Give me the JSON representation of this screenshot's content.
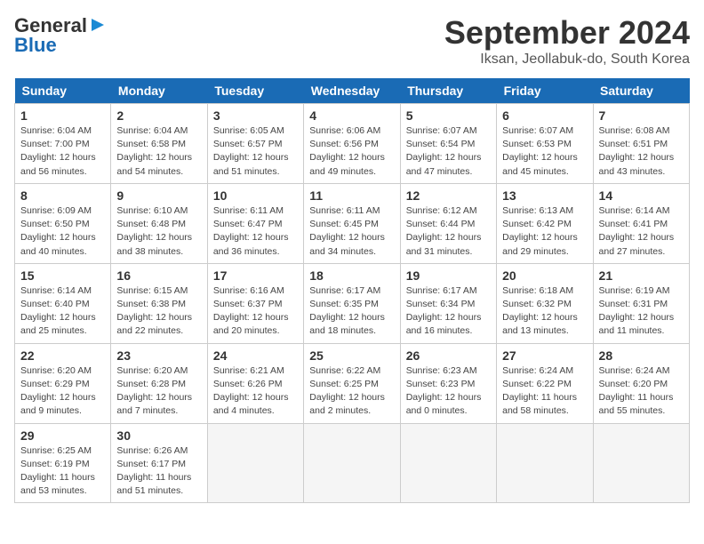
{
  "header": {
    "logo_general": "General",
    "logo_blue": "Blue",
    "month": "September 2024",
    "location": "Iksan, Jeollabuk-do, South Korea"
  },
  "weekdays": [
    "Sunday",
    "Monday",
    "Tuesday",
    "Wednesday",
    "Thursday",
    "Friday",
    "Saturday"
  ],
  "weeks": [
    [
      {
        "day": "1",
        "sunrise": "6:04 AM",
        "sunset": "7:00 PM",
        "daylight": "12 hours and 56 minutes."
      },
      {
        "day": "2",
        "sunrise": "6:04 AM",
        "sunset": "6:58 PM",
        "daylight": "12 hours and 54 minutes."
      },
      {
        "day": "3",
        "sunrise": "6:05 AM",
        "sunset": "6:57 PM",
        "daylight": "12 hours and 51 minutes."
      },
      {
        "day": "4",
        "sunrise": "6:06 AM",
        "sunset": "6:56 PM",
        "daylight": "12 hours and 49 minutes."
      },
      {
        "day": "5",
        "sunrise": "6:07 AM",
        "sunset": "6:54 PM",
        "daylight": "12 hours and 47 minutes."
      },
      {
        "day": "6",
        "sunrise": "6:07 AM",
        "sunset": "6:53 PM",
        "daylight": "12 hours and 45 minutes."
      },
      {
        "day": "7",
        "sunrise": "6:08 AM",
        "sunset": "6:51 PM",
        "daylight": "12 hours and 43 minutes."
      }
    ],
    [
      {
        "day": "8",
        "sunrise": "6:09 AM",
        "sunset": "6:50 PM",
        "daylight": "12 hours and 40 minutes."
      },
      {
        "day": "9",
        "sunrise": "6:10 AM",
        "sunset": "6:48 PM",
        "daylight": "12 hours and 38 minutes."
      },
      {
        "day": "10",
        "sunrise": "6:11 AM",
        "sunset": "6:47 PM",
        "daylight": "12 hours and 36 minutes."
      },
      {
        "day": "11",
        "sunrise": "6:11 AM",
        "sunset": "6:45 PM",
        "daylight": "12 hours and 34 minutes."
      },
      {
        "day": "12",
        "sunrise": "6:12 AM",
        "sunset": "6:44 PM",
        "daylight": "12 hours and 31 minutes."
      },
      {
        "day": "13",
        "sunrise": "6:13 AM",
        "sunset": "6:42 PM",
        "daylight": "12 hours and 29 minutes."
      },
      {
        "day": "14",
        "sunrise": "6:14 AM",
        "sunset": "6:41 PM",
        "daylight": "12 hours and 27 minutes."
      }
    ],
    [
      {
        "day": "15",
        "sunrise": "6:14 AM",
        "sunset": "6:40 PM",
        "daylight": "12 hours and 25 minutes."
      },
      {
        "day": "16",
        "sunrise": "6:15 AM",
        "sunset": "6:38 PM",
        "daylight": "12 hours and 22 minutes."
      },
      {
        "day": "17",
        "sunrise": "6:16 AM",
        "sunset": "6:37 PM",
        "daylight": "12 hours and 20 minutes."
      },
      {
        "day": "18",
        "sunrise": "6:17 AM",
        "sunset": "6:35 PM",
        "daylight": "12 hours and 18 minutes."
      },
      {
        "day": "19",
        "sunrise": "6:17 AM",
        "sunset": "6:34 PM",
        "daylight": "12 hours and 16 minutes."
      },
      {
        "day": "20",
        "sunrise": "6:18 AM",
        "sunset": "6:32 PM",
        "daylight": "12 hours and 13 minutes."
      },
      {
        "day": "21",
        "sunrise": "6:19 AM",
        "sunset": "6:31 PM",
        "daylight": "12 hours and 11 minutes."
      }
    ],
    [
      {
        "day": "22",
        "sunrise": "6:20 AM",
        "sunset": "6:29 PM",
        "daylight": "12 hours and 9 minutes."
      },
      {
        "day": "23",
        "sunrise": "6:20 AM",
        "sunset": "6:28 PM",
        "daylight": "12 hours and 7 minutes."
      },
      {
        "day": "24",
        "sunrise": "6:21 AM",
        "sunset": "6:26 PM",
        "daylight": "12 hours and 4 minutes."
      },
      {
        "day": "25",
        "sunrise": "6:22 AM",
        "sunset": "6:25 PM",
        "daylight": "12 hours and 2 minutes."
      },
      {
        "day": "26",
        "sunrise": "6:23 AM",
        "sunset": "6:23 PM",
        "daylight": "12 hours and 0 minutes."
      },
      {
        "day": "27",
        "sunrise": "6:24 AM",
        "sunset": "6:22 PM",
        "daylight": "11 hours and 58 minutes."
      },
      {
        "day": "28",
        "sunrise": "6:24 AM",
        "sunset": "6:20 PM",
        "daylight": "11 hours and 55 minutes."
      }
    ],
    [
      {
        "day": "29",
        "sunrise": "6:25 AM",
        "sunset": "6:19 PM",
        "daylight": "11 hours and 53 minutes."
      },
      {
        "day": "30",
        "sunrise": "6:26 AM",
        "sunset": "6:17 PM",
        "daylight": "11 hours and 51 minutes."
      },
      null,
      null,
      null,
      null,
      null
    ]
  ]
}
